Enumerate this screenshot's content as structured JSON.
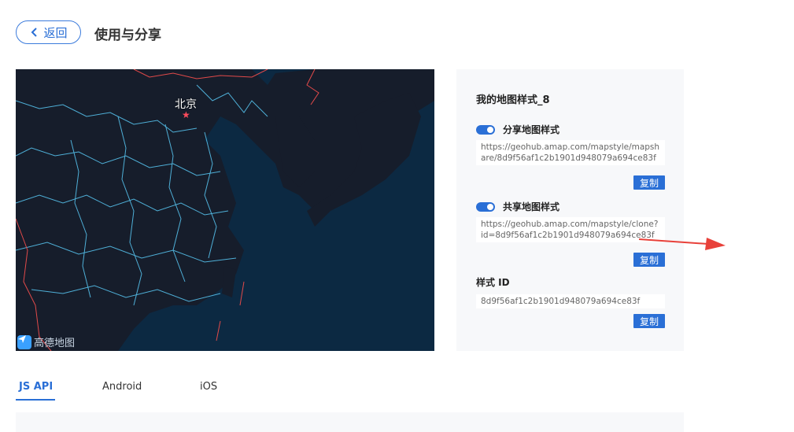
{
  "header": {
    "back_label": "返回",
    "title": "使用与分享"
  },
  "map": {
    "city_label": "北京",
    "star": "★",
    "logo_text": "高德地图"
  },
  "panel": {
    "style_name": "我的地图样式_8",
    "share": {
      "label": "分享地图样式",
      "url": "https://geohub.amap.com/mapstyle/mapshare/8d9f56af1c2b1901d948079a694ce83f",
      "copy_label": "复制"
    },
    "clone": {
      "label": "共享地图样式",
      "url": "https://geohub.amap.com/mapstyle/clone?id=8d9f56af1c2b1901d948079a694ce83f",
      "copy_label": "复制"
    },
    "style_id": {
      "label": "样式 ID",
      "value": "8d9f56af1c2b1901d948079a694ce83f",
      "copy_label": "复制"
    }
  },
  "tabs": [
    "JS API",
    "Android",
    "iOS"
  ],
  "colors": {
    "accent": "#2a6fd6",
    "map_bg": "#0c2942",
    "arrow": "#e8413a"
  }
}
